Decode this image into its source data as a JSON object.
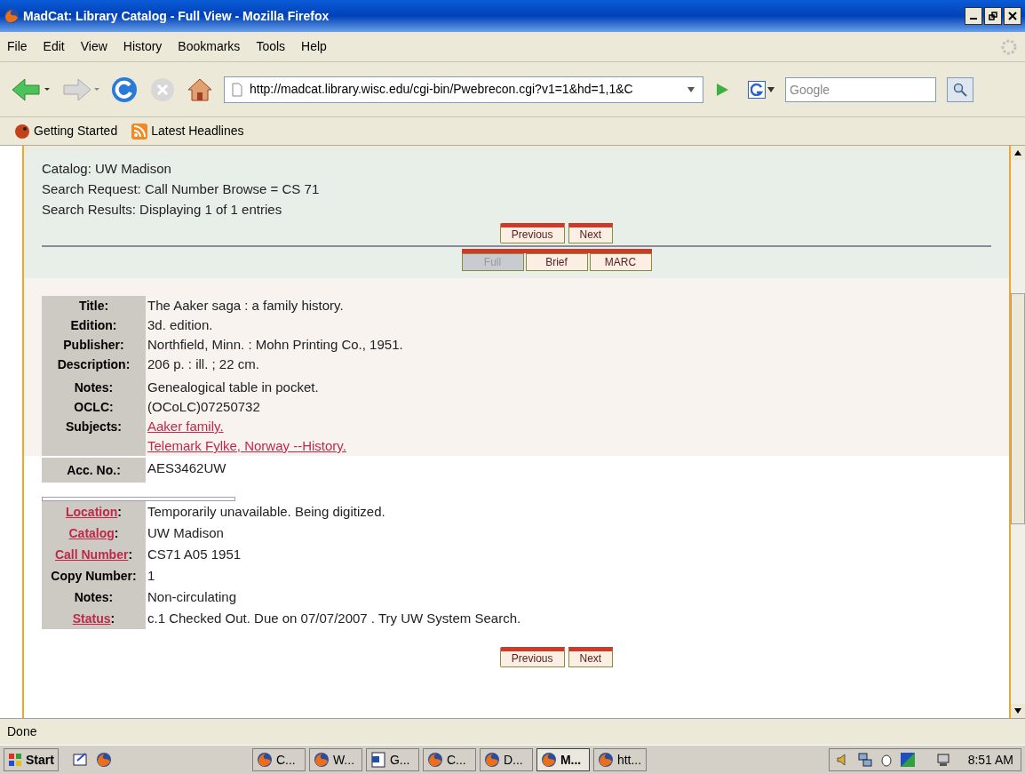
{
  "window": {
    "title": "MadCat: Library Catalog - Full View - Mozilla Firefox"
  },
  "menu": [
    "File",
    "Edit",
    "View",
    "History",
    "Bookmarks",
    "Tools",
    "Help"
  ],
  "toolbar": {
    "url": "http://madcat.library.wisc.edu/cgi-bin/Pwebrecon.cgi?v1=1&hd=1,1&C",
    "search_placeholder": "Google"
  },
  "bookmarks": [
    {
      "label": "Getting Started",
      "kind": "site"
    },
    {
      "label": "Latest Headlines",
      "kind": "feed"
    }
  ],
  "search_info": [
    "Catalog: UW Madison",
    "Search Request: Call Number Browse = CS 71",
    "Search Results: Displaying 1 of 1 entries"
  ],
  "pager_top": [
    "Previous",
    "Next"
  ],
  "views": [
    {
      "label": "Full",
      "selected": true
    },
    {
      "label": "Brief",
      "selected": false
    },
    {
      "label": "MARC",
      "selected": false
    }
  ],
  "record": [
    {
      "label": "Title:",
      "values": [
        {
          "text": "The Aaker saga : a family history.",
          "link": false
        }
      ]
    },
    {
      "label": "Edition:",
      "values": [
        {
          "text": "3d. edition.",
          "link": false
        }
      ]
    },
    {
      "label": "Publisher:",
      "values": [
        {
          "text": "Northfield, Minn. : Mohn Printing Co., 1951.",
          "link": false
        }
      ]
    },
    {
      "label": "Description:",
      "values": [
        {
          "text": "206 p. : ill. ; 22 cm.",
          "link": false
        }
      ]
    },
    {
      "label": "Notes:",
      "values": [
        {
          "text": "Genealogical table in pocket.",
          "link": false
        }
      ]
    },
    {
      "label": "OCLC:",
      "values": [
        {
          "text": "(OCoLC)07250732",
          "link": false
        }
      ]
    },
    {
      "label": "Subjects:",
      "values": [
        {
          "text": "Aaker family.",
          "link": true
        },
        {
          "text": "Telemark Fylke, Norway --History.",
          "link": true
        }
      ]
    }
  ],
  "acc_no": {
    "label": "Acc. No.:",
    "value": "AES3462UW"
  },
  "holdings": [
    {
      "label": "Location",
      "sep": ":",
      "link": true,
      "value": "Temporarily unavailable. Being digitized."
    },
    {
      "label": "Catalog",
      "sep": ":",
      "link": true,
      "value": "UW Madison"
    },
    {
      "label": "Call Number",
      "sep": ":",
      "link": true,
      "value": "CS71 A05 1951"
    },
    {
      "label": "Copy Number",
      "sep": ":",
      "link": false,
      "value": "1"
    },
    {
      "label": "Notes",
      "sep": ":",
      "link": false,
      "value": "Non-circulating"
    },
    {
      "label": "Status",
      "sep": ":",
      "link": true,
      "value": "c.1 Checked Out. Due on 07/07/2007 . Try UW System Search."
    }
  ],
  "pager_bottom": [
    "Previous",
    "Next"
  ],
  "status_bar": "Done",
  "taskbar": {
    "start": "Start",
    "tasks": [
      {
        "label": "C...",
        "kind": "firefox",
        "selected": false
      },
      {
        "label": "W...",
        "kind": "firefox",
        "selected": false
      },
      {
        "label": "G...",
        "kind": "word",
        "selected": false
      },
      {
        "label": "C...",
        "kind": "firefox",
        "selected": false
      },
      {
        "label": "D...",
        "kind": "firefox",
        "selected": false
      },
      {
        "label": "M...",
        "kind": "firefox",
        "selected": true
      },
      {
        "label": "htt...",
        "kind": "firefox",
        "selected": false
      }
    ],
    "clock": "8:51 AM"
  }
}
